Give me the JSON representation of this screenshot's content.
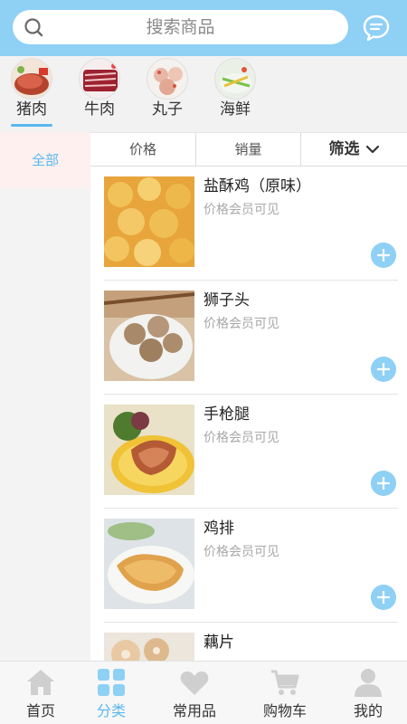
{
  "search": {
    "placeholder": "搜索商品"
  },
  "categories": [
    {
      "label": "猪肉",
      "active": true
    },
    {
      "label": "牛肉",
      "active": false
    },
    {
      "label": "丸子",
      "active": false
    },
    {
      "label": "海鲜",
      "active": false
    }
  ],
  "sidebar": {
    "items": [
      {
        "label": "全部",
        "active": true
      }
    ]
  },
  "sort": {
    "price": "价格",
    "sales": "销量",
    "filter": "筛选"
  },
  "products": [
    {
      "name": "盐酥鸡（原味）",
      "price": "价格会员可见"
    },
    {
      "name": "狮子头",
      "price": "价格会员可见"
    },
    {
      "name": "手枪腿",
      "price": "价格会员可见"
    },
    {
      "name": "鸡排",
      "price": "价格会员可见"
    },
    {
      "name": "藕片",
      "price": ""
    }
  ],
  "tabs": [
    {
      "label": "首页",
      "icon": "home-icon",
      "active": false
    },
    {
      "label": "分类",
      "icon": "category-icon",
      "active": true
    },
    {
      "label": "常用品",
      "icon": "heart-icon",
      "active": false
    },
    {
      "label": "购物车",
      "icon": "cart-icon",
      "active": false
    },
    {
      "label": "我的",
      "icon": "user-icon",
      "active": false
    }
  ],
  "colors": {
    "accent": "#5ab8ef",
    "header": "#8fd0f5",
    "tab_icon_inactive": "#cfcfcf",
    "tab_icon_active": "#8fd0f5"
  }
}
